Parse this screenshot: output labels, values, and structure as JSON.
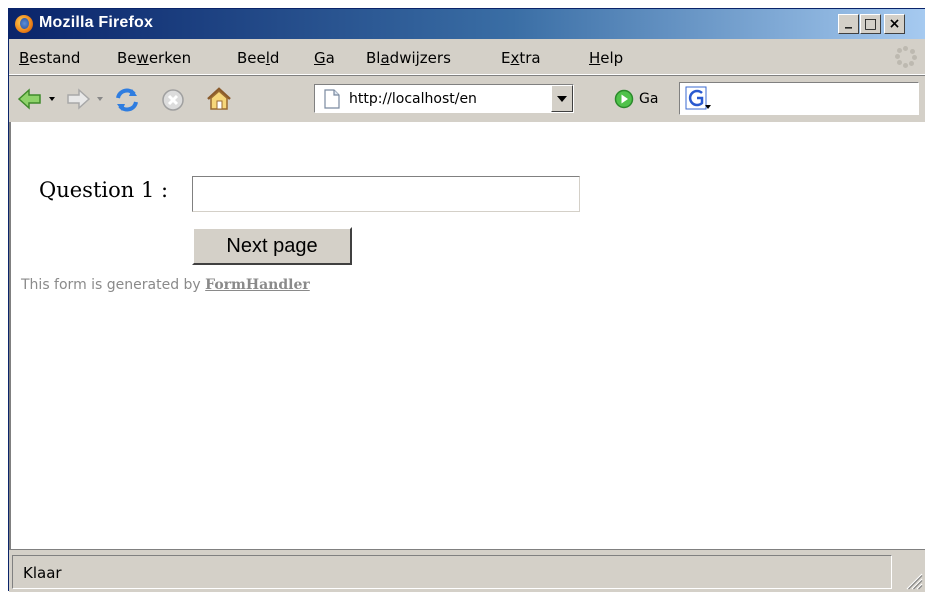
{
  "window": {
    "title": "Mozilla Firefox",
    "controls": {
      "minimize": "_",
      "maximize": "□",
      "close": "×"
    }
  },
  "menu": {
    "items": [
      {
        "label": "Bestand",
        "accel": "B",
        "rest": "estand"
      },
      {
        "label": "Bewerken",
        "pre": "Be",
        "accel": "w",
        "rest": "erken"
      },
      {
        "label": "Beeld",
        "pre": "Bee",
        "accel": "l",
        "rest": "d"
      },
      {
        "label": "Ga",
        "accel": "G",
        "rest": "a"
      },
      {
        "label": "Bladwijzers",
        "pre": "Bl",
        "accel": "a",
        "rest": "dwijzers"
      },
      {
        "label": "Extra",
        "pre": "E",
        "accel": "x",
        "rest": "tra"
      },
      {
        "label": "Help",
        "accel": "H",
        "rest": "elp"
      }
    ]
  },
  "toolbar": {
    "url": "http://localhost/en",
    "go_label": "Ga",
    "search_value": ""
  },
  "form": {
    "question_label": "Question 1 :",
    "question_value": "",
    "next_button": "Next page",
    "footer_prefix": "This form is generated by",
    "footer_link": "FormHandler"
  },
  "status": {
    "text": "Klaar"
  },
  "colors": {
    "titlebar_start": "#0a246a",
    "titlebar_end": "#a6caf0",
    "chrome": "#d4d0c8",
    "footer_text": "#8a8a8a"
  }
}
